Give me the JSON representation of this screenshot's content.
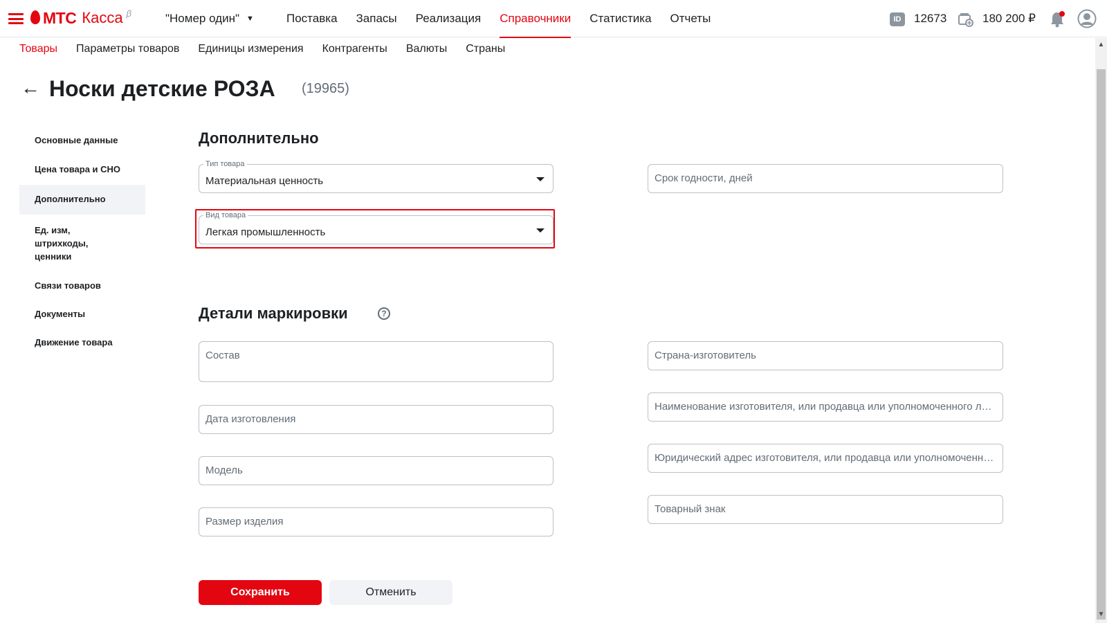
{
  "header": {
    "logo_mts": "МТС",
    "logo_kassa": "Касса",
    "logo_beta": "β",
    "org_name": "\"Номер один\"",
    "nav": [
      {
        "label": "Поставка"
      },
      {
        "label": "Запасы"
      },
      {
        "label": "Реализация"
      },
      {
        "label": "Справочники",
        "active": true
      },
      {
        "label": "Статистика"
      },
      {
        "label": "Отчеты"
      }
    ],
    "id_icon": "ID",
    "id_value": "12673",
    "balance": "180 200 ₽"
  },
  "subnav": [
    {
      "label": "Товары",
      "active": true
    },
    {
      "label": "Параметры товаров"
    },
    {
      "label": "Единицы измерения"
    },
    {
      "label": "Контрагенты"
    },
    {
      "label": "Валюты"
    },
    {
      "label": "Страны"
    }
  ],
  "page": {
    "back_icon": "←",
    "title": "Носки детские РОЗА",
    "code": "(19965)"
  },
  "sidemenu": [
    {
      "label": "Основные данные"
    },
    {
      "label": "Цена товара и СНО"
    },
    {
      "label": "Дополнительно",
      "active": true
    },
    {
      "label": "Ед. изм, штрихкоды, ценники"
    },
    {
      "label": "Связи товаров"
    },
    {
      "label": "Документы"
    },
    {
      "label": "Движение товара"
    }
  ],
  "additional": {
    "title": "Дополнительно",
    "product_type": {
      "label": "Тип товара",
      "value": "Материальная ценность"
    },
    "product_kind": {
      "label": "Вид товара",
      "value": "Легкая промышленность"
    },
    "shelf_life_placeholder": "Срок годности, дней"
  },
  "marking": {
    "title": "Детали маркировки",
    "help_icon": "?",
    "composition": "Состав",
    "manufacture_date": "Дата изготовления",
    "model": "Модель",
    "size": "Размер изделия",
    "country": "Страна-изготовитель",
    "manufacturer_name": "Наименование изготовителя, или продавца или уполномоченного лица",
    "legal_address": "Юридический адрес изготовителя, или продавца или уполномоченного лица",
    "trademark": "Товарный знак"
  },
  "buttons": {
    "save": "Сохранить",
    "cancel": "Отменить"
  },
  "colors": {
    "accent": "#e30611",
    "text": "#1d2023",
    "secondary_text": "#626c77",
    "border": "#bbc1c7"
  }
}
